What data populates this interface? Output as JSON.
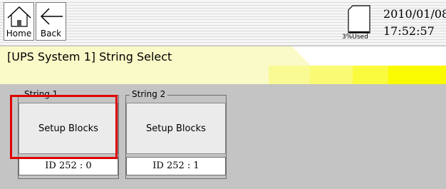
{
  "toolbar": {
    "home_label": "Home",
    "back_label": "Back",
    "storage_used": "3%Used",
    "date": "2010/01/08",
    "time": "17:52:57"
  },
  "title": "[UPS System 1] String Select",
  "strings": [
    {
      "legend": "String 1",
      "button_label": "Setup Blocks",
      "id_label": "ID 252 : 0"
    },
    {
      "legend": "String 2",
      "button_label": "Setup Blocks",
      "id_label": "ID 252 : 1"
    }
  ],
  "colors": {
    "highlight": "#e00000",
    "title_yellow": "#fafac8",
    "content_gray": "#c4c4c4"
  }
}
